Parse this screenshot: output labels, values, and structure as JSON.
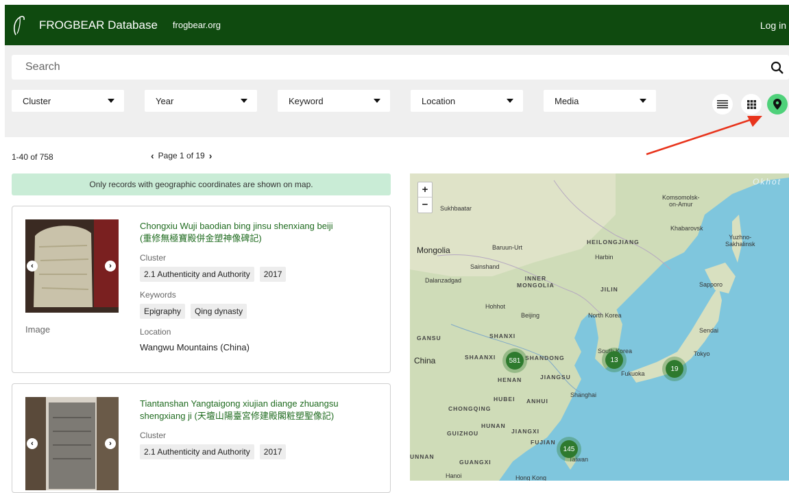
{
  "header": {
    "brand": "FROGBEAR Database",
    "site": "frogbear.org",
    "login": "Log in"
  },
  "search": {
    "placeholder": "Search"
  },
  "filters": [
    {
      "label": "Cluster"
    },
    {
      "label": "Year"
    },
    {
      "label": "Keyword"
    },
    {
      "label": "Location"
    },
    {
      "label": "Media"
    }
  ],
  "view_buttons": {
    "list": "list-icon",
    "grid": "grid-icon",
    "map": "map-pin-icon",
    "active": "map"
  },
  "results": {
    "count": "1-40 of 758",
    "page": "Page 1 of 19"
  },
  "notice": "Only records with geographic coordinates are shown on map.",
  "records": [
    {
      "title": "Chongxiu Wuji baodian bing jinsu shenxiang beiji (重修無極寶殿併金塑神像碑記)",
      "image_label": "Image",
      "cluster_label": "Cluster",
      "cluster": "2.1 Authenticity and Authority",
      "year": "2017",
      "keywords_label": "Keywords",
      "keywords": [
        "Epigraphy",
        "Qing dynasty"
      ],
      "location_label": "Location",
      "location": "Wangwu Mountains (China)"
    },
    {
      "title": "Tiantanshan Yangtaigong xiujian diange zhuangsu shengxiang ji (天壇山陽臺宮修建殿閣粧塑聖像記)",
      "cluster_label": "Cluster",
      "cluster": "2.1 Authenticity and Authority",
      "year": "2017"
    }
  ],
  "map": {
    "zoom_in": "+",
    "zoom_out": "−",
    "labels": {
      "okhot": "Okhot",
      "komsomolsk": "Komsomolsk-\non-Amur",
      "sukhbaatar": "Sukhbaatar",
      "khabarovsk": "Khabarovsk",
      "yuzhno": "Yuzhno-\nSakhalinsk",
      "mongolia": "Mongolia",
      "baruun": "Baruun-Urt",
      "heilongjiang": "HEILONGJIANG",
      "harbin": "Harbin",
      "sainshand": "Sainshand",
      "dalanzadgad": "Dalanzadgad",
      "innermongolia": "INNER\nMONGOLIA",
      "jilin": "JILIN",
      "sapporo": "Sapporo",
      "hohhot": "Hohhot",
      "beijing": "Beijing",
      "northkorea": "North Korea",
      "gansu": "GANSU",
      "shanxi": "SHANXI",
      "sendai": "Sendai",
      "china": "China",
      "shaanxi": "SHAANXI",
      "shandong": "SHANDONG",
      "southkorea": "South Korea",
      "tokyo": "Tokyo",
      "henan": "HENAN",
      "jiangsu": "JIANGSU",
      "fukuoka": "Fukuoka",
      "shanghai": "Shanghai",
      "hubei": "HUBEI",
      "anhui": "ANHUI",
      "chongqing": "CHONGQING",
      "hunan": "HUNAN",
      "jiangxi": "JIANGXI",
      "guizhou": "GUIZHOU",
      "fujian": "FUJIAN",
      "taiwan": "Taiwan",
      "yunnan": "UNNAN",
      "guangxi": "GUANGXI",
      "hanoi": "Hanoi",
      "hongkong": "Hong Kong"
    },
    "clusters": [
      {
        "count": "581"
      },
      {
        "count": "13"
      },
      {
        "count": "19"
      },
      {
        "count": "145"
      }
    ]
  },
  "colors": {
    "header_bg": "#0f4a0f",
    "accent": "#4fd17a",
    "title_green": "#1f6b1f",
    "notice_bg": "#c9ecd6",
    "cluster": "#2e7a2e"
  }
}
